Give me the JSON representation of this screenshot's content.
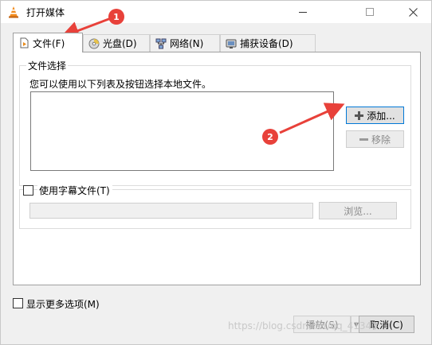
{
  "window": {
    "title": "打开媒体"
  },
  "tabs": [
    {
      "label": "文件(F)",
      "icon": "file-icon",
      "active": true
    },
    {
      "label": "光盘(D)",
      "icon": "disc-icon",
      "active": false
    },
    {
      "label": "网络(N)",
      "icon": "network-icon",
      "active": false
    },
    {
      "label": "捕获设备(D)",
      "icon": "capture-device-icon",
      "active": false
    }
  ],
  "file_group": {
    "legend": "文件选择",
    "description": "您可以使用以下列表及按钮选择本地文件。",
    "add_label": "添加...",
    "remove_label": "移除"
  },
  "subtitle": {
    "label": "使用字幕文件(T)",
    "browse_label": "浏览...",
    "checked": false
  },
  "more_options": {
    "label": "显示更多选项(M)",
    "checked": false
  },
  "footer": {
    "play_label": "播放(S)",
    "cancel_label": "取消(C)"
  },
  "annotations": [
    "1",
    "2"
  ],
  "colors": {
    "accent": "#0078d7",
    "annotation": "#e8413a"
  }
}
